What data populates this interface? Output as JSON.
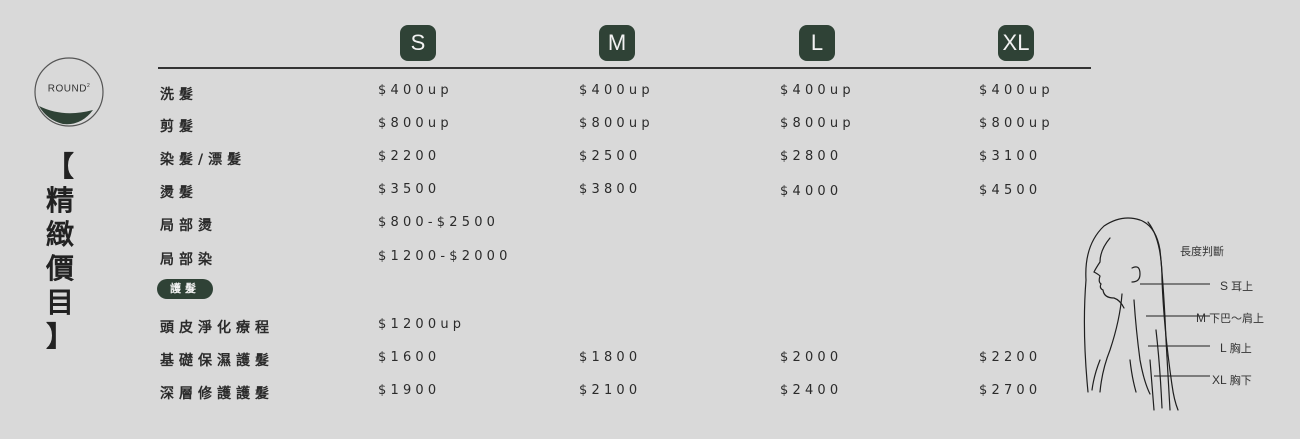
{
  "brand": {
    "name": "ROUND",
    "superscript": "2"
  },
  "title_chars": [
    "【",
    "精",
    "緻",
    "價",
    "目",
    "】"
  ],
  "sizes": [
    "S",
    "M",
    "L",
    "XL"
  ],
  "services": [
    {
      "name": "洗髮",
      "prices": [
        "$400up",
        "$400up",
        "$400up",
        "$400up"
      ]
    },
    {
      "name": "剪髮",
      "prices": [
        "$800up",
        "$800up",
        "$800up",
        "$800up"
      ]
    },
    {
      "name": "染髮/漂髮",
      "prices": [
        "$2200",
        "$2500",
        "$2800",
        "$3100"
      ]
    },
    {
      "name": "燙髮",
      "prices": [
        "$3500",
        "$3800",
        "$4000",
        "$4500"
      ]
    },
    {
      "name": "局部燙",
      "prices": [
        "$800-$2500",
        "",
        "",
        ""
      ]
    },
    {
      "name": "局部染",
      "prices": [
        "$1200-$2000",
        "",
        "",
        ""
      ]
    }
  ],
  "care_section": {
    "label": "護髮"
  },
  "care_services": [
    {
      "name": "頭皮淨化療程",
      "prices": [
        "$1200up",
        "",
        "",
        ""
      ]
    },
    {
      "name": "基礎保濕護髮",
      "prices": [
        "$1600",
        "$1800",
        "$2000",
        "$2200"
      ]
    },
    {
      "name": "深層修護護髮",
      "prices": [
        "$1900",
        "$2100",
        "$2400",
        "$2700"
      ]
    }
  ],
  "length_guide": {
    "title": "長度判斷",
    "items": [
      {
        "size": "S",
        "desc": "耳上"
      },
      {
        "size": "M",
        "desc": "下巴～肩上"
      },
      {
        "size": "L",
        "desc": "胸上"
      },
      {
        "size": "XL",
        "desc": "胸下"
      }
    ]
  },
  "colors": {
    "accent": "#2f4236",
    "background": "#d9d9d9",
    "text": "#2b2b2b"
  }
}
